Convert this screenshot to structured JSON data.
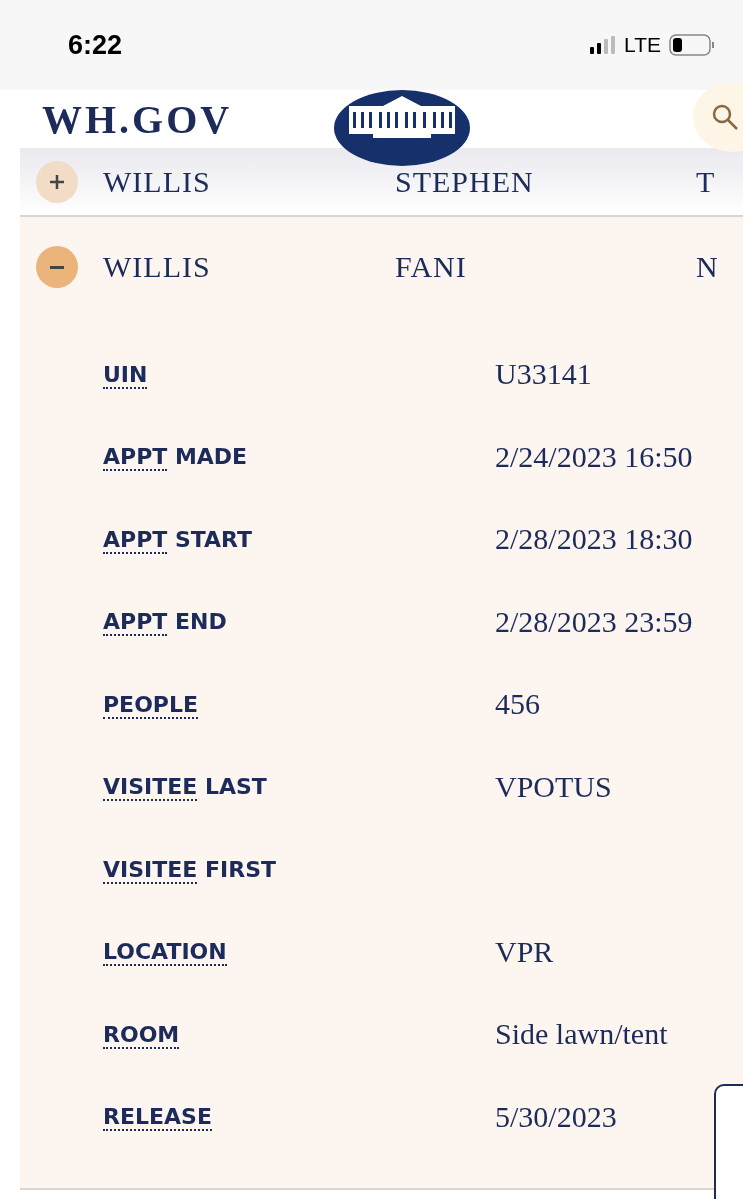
{
  "status_bar": {
    "time": "6:22",
    "network": "LTE"
  },
  "header": {
    "site_name": "WH.GOV"
  },
  "records": [
    {
      "last_name": "WILLIS",
      "first_name": "STEPHEN",
      "middle": "T",
      "expanded": false
    },
    {
      "last_name": "WILLIS",
      "first_name": "FANI",
      "middle": "N",
      "expanded": true,
      "details": [
        {
          "term": "UIN",
          "value": "U33141"
        },
        {
          "term": "APPT",
          "term_rest": "MADE",
          "value": "2/24/2023 16:50"
        },
        {
          "term": "APPT",
          "term_rest": "START",
          "value": "2/28/2023 18:30"
        },
        {
          "term": "APPT",
          "term_rest": "END",
          "value": "2/28/2023 23:59"
        },
        {
          "term": "PEOPLE",
          "value": "456"
        },
        {
          "term": "VISITEE",
          "term_rest": "LAST",
          "value": "VPOTUS"
        },
        {
          "term": "VISITEE",
          "term_rest": "FIRST"
        },
        {
          "term": "LOCATION",
          "value": "VPR"
        },
        {
          "term": "ROOM",
          "value": "Side lawn/tent"
        },
        {
          "term": "RELEASE",
          "value": "5/30/2023"
        }
      ]
    }
  ]
}
